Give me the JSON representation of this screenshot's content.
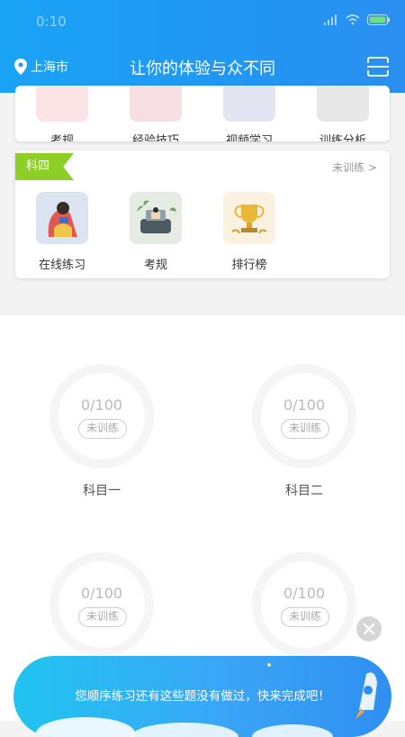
{
  "status": {
    "time": "0:10"
  },
  "header": {
    "location": "上海市",
    "title": "让你的体验与众不同"
  },
  "card1": {
    "items": [
      {
        "label": "考规"
      },
      {
        "label": "经验技巧"
      },
      {
        "label": "视频学习"
      },
      {
        "label": "训练分析"
      }
    ]
  },
  "card2": {
    "tag": "科四",
    "status": "未训练 >",
    "items": [
      {
        "label": "在线练习"
      },
      {
        "label": "考规"
      },
      {
        "label": "排行榜"
      }
    ]
  },
  "progress": [
    {
      "score": "0/100",
      "status": "未训练",
      "label": "科目一"
    },
    {
      "score": "0/100",
      "status": "未训练",
      "label": "科目二"
    },
    {
      "score": "0/100",
      "status": "未训练",
      "label": ""
    },
    {
      "score": "0/100",
      "status": "未训练",
      "label": ""
    }
  ],
  "banner": {
    "text": "您顺序练习还有这些题没有做过，快来完成吧！"
  },
  "colors": {
    "primary": "#2196f3",
    "tag_green": "#8ecf27"
  }
}
